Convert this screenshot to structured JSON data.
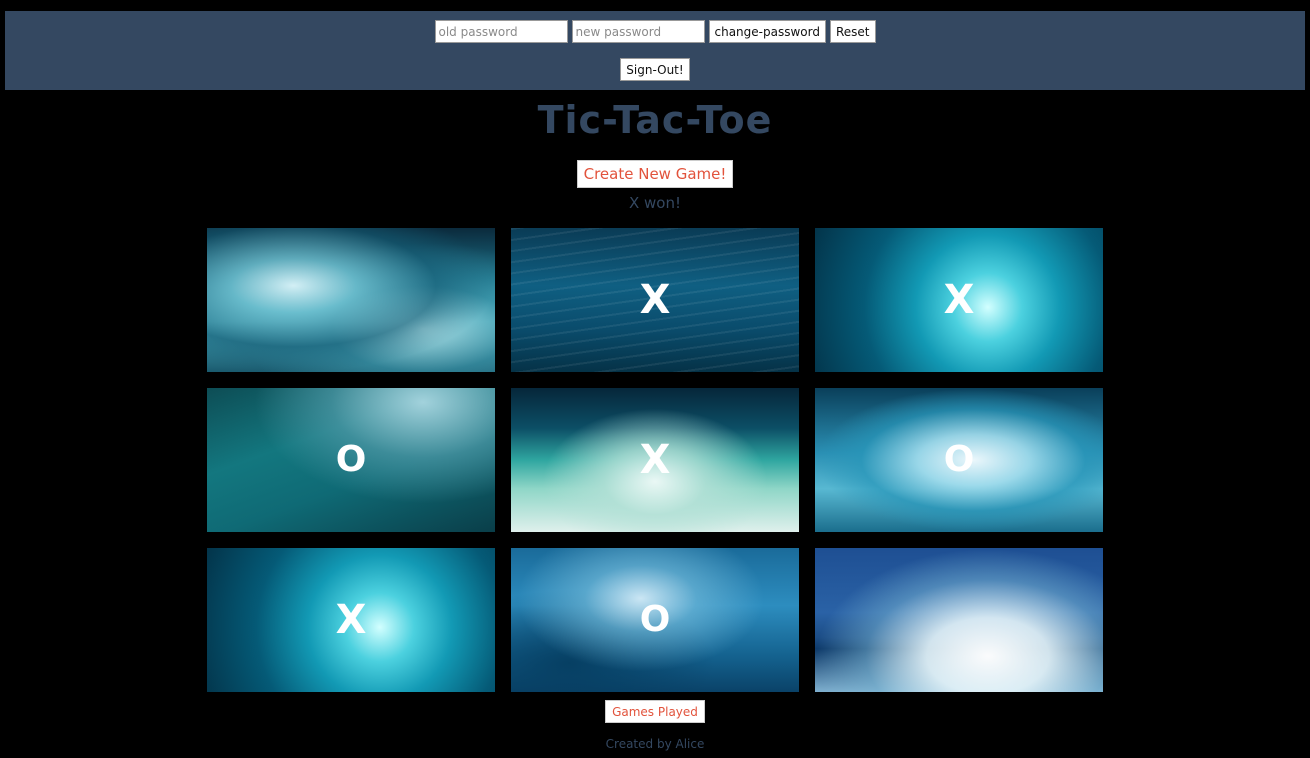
{
  "header": {
    "old_password_placeholder": "old password",
    "new_password_placeholder": "new password",
    "change_password_label": "change-password",
    "reset_label": "Reset",
    "signout_label": "Sign-Out!"
  },
  "title": "Tic-Tac-Toe",
  "create_game_label": "Create New Game!",
  "status": "X won!",
  "board": {
    "cells": [
      {
        "mark": "",
        "image": "ocean-wave"
      },
      {
        "mark": "X",
        "image": "deep-water"
      },
      {
        "mark": "X",
        "image": "underwater-bubbles"
      },
      {
        "mark": "O",
        "image": "blurred-wave"
      },
      {
        "mark": "X",
        "image": "breaking-wave"
      },
      {
        "mark": "O",
        "image": "splashing-wave"
      },
      {
        "mark": "X",
        "image": "underwater-bubbles"
      },
      {
        "mark": "O",
        "image": "foamy-water"
      },
      {
        "mark": "",
        "image": "sea-spray"
      }
    ]
  },
  "games_played_label": "Games Played",
  "credit": "Created by Alice",
  "colors": {
    "header_bg": "#344861",
    "title": "#344861",
    "accent": "#e2533c",
    "background": "#000000"
  }
}
